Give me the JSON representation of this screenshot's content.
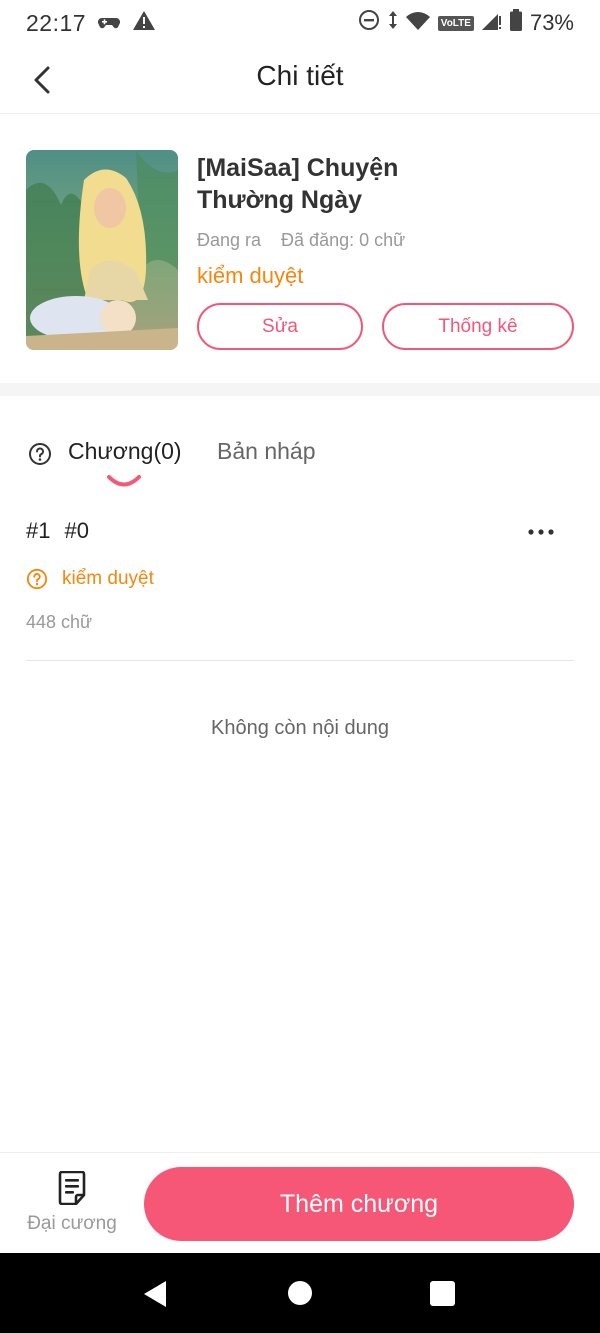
{
  "status_bar": {
    "time": "22:17",
    "battery": "73%",
    "network": "VoLTE"
  },
  "app_bar": {
    "title": "Chi tiết"
  },
  "book": {
    "title": "[MaiSaa] Chuyện Thường Ngày",
    "state": "Đang ra",
    "published": "Đã đăng: 0 chữ",
    "review_status": "kiểm duyệt",
    "edit_label": "Sửa",
    "stats_label": "Thống kê"
  },
  "tabs": {
    "chapters": "Chương(0)",
    "drafts": "Bản nháp"
  },
  "chapter": {
    "number": "#1",
    "name": "#0",
    "status": "kiểm duyệt",
    "words": "448 chữ"
  },
  "empty_message": "Không còn nội dung",
  "bottom": {
    "outline_label": "Đại cương",
    "add_label": "Thêm chương"
  },
  "colors": {
    "accent": "#f65776",
    "accent_outline": "#f0587a",
    "warning": "#f5870f"
  }
}
